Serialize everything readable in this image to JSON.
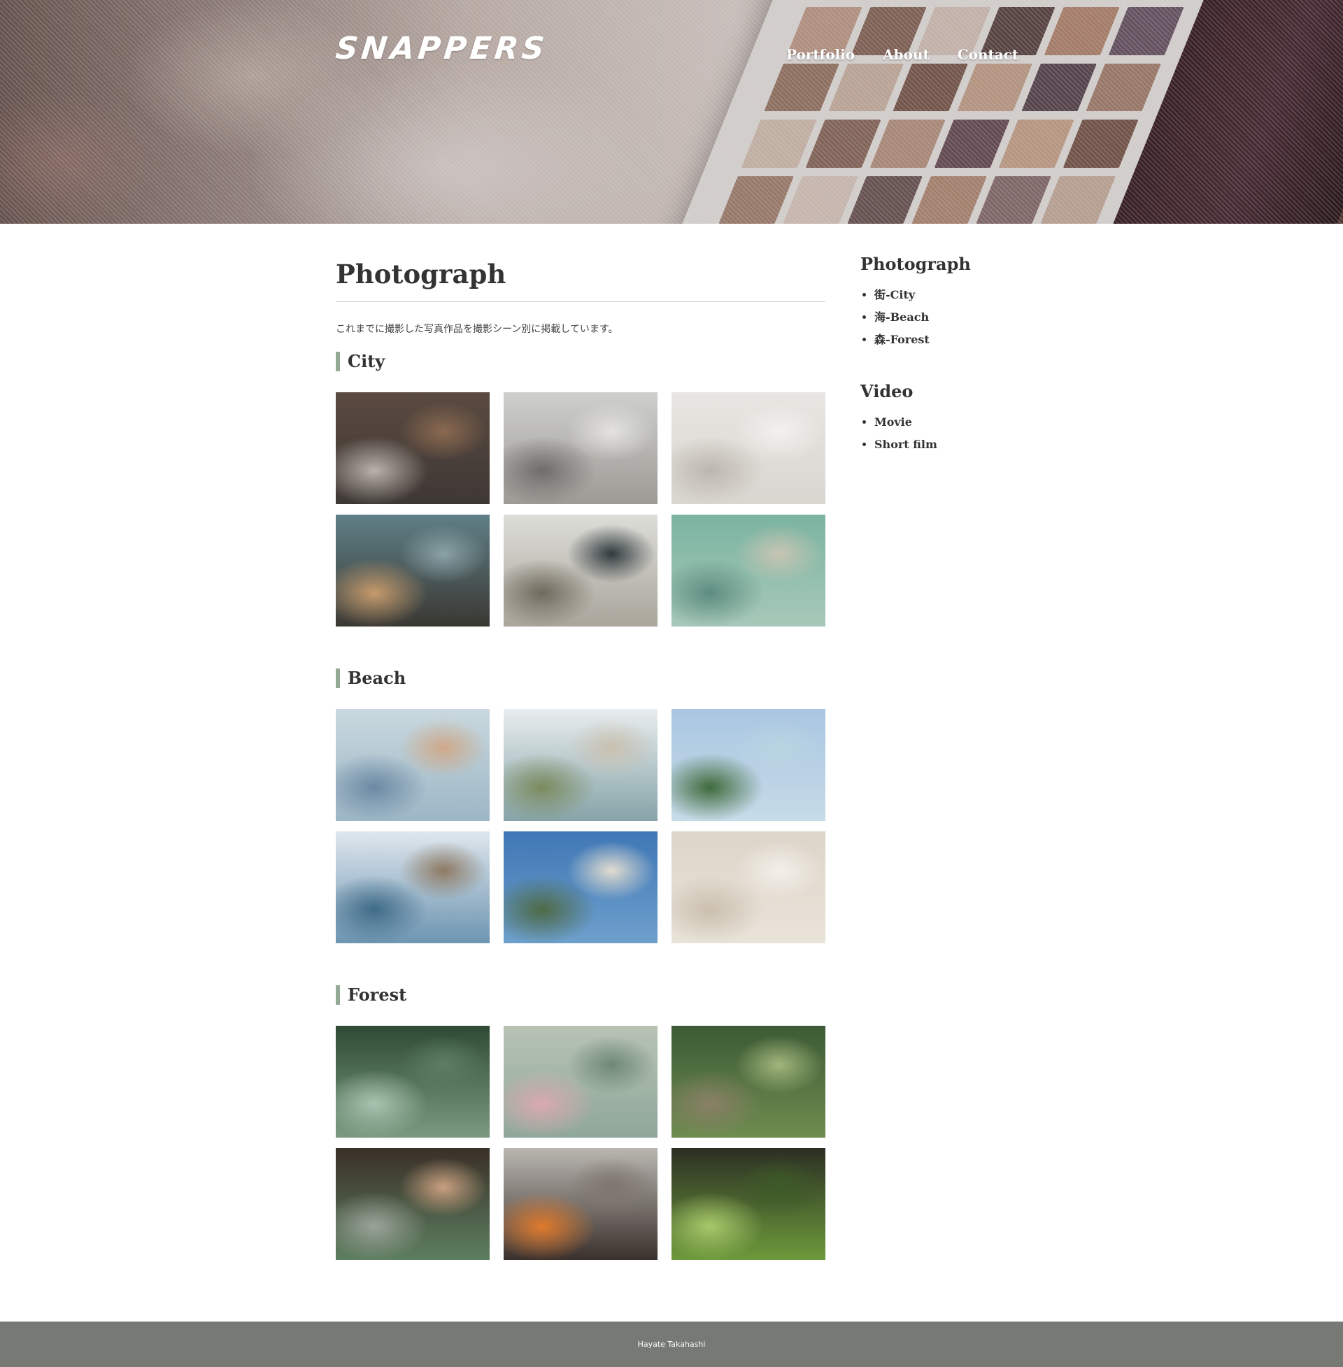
{
  "site": {
    "logo": "SNAPPERS"
  },
  "nav": [
    {
      "label": "Portfolio"
    },
    {
      "label": "About"
    },
    {
      "label": "Contact"
    }
  ],
  "main": {
    "title": "Photograph",
    "intro": "これまでに撮影した写真作品を撮影シーン別に掲載しています。",
    "sections": [
      {
        "title": "City",
        "photos": [
          {
            "colors": [
              "#5a4a40",
              "#3e3835",
              "#b8b2aa",
              "#8b6a50"
            ]
          },
          {
            "colors": [
              "#cfcfcc",
              "#9c9a95",
              "#6e6d6a",
              "#e3e2df"
            ]
          },
          {
            "colors": [
              "#e8e6e2",
              "#d9d6d0",
              "#bcb7ae",
              "#f2f1ee"
            ]
          },
          {
            "colors": [
              "#5f7f86",
              "#3a3833",
              "#c69a6b",
              "#8aa1a6"
            ]
          },
          {
            "colors": [
              "#ddddd8",
              "#a9a59b",
              "#6f6a5d",
              "#2f3a3d"
            ]
          },
          {
            "colors": [
              "#7bb4a1",
              "#a7c8b8",
              "#5d8c7f",
              "#c8c4b2"
            ]
          }
        ]
      },
      {
        "title": "Beach",
        "photos": [
          {
            "colors": [
              "#c9d8de",
              "#9db7c6",
              "#6b89a3",
              "#cfa989"
            ]
          },
          {
            "colors": [
              "#e9edef",
              "#86a4a8",
              "#7a8a5e",
              "#c9c1b0"
            ]
          },
          {
            "colors": [
              "#a9c6e2",
              "#c7dbe8",
              "#3e6a3a",
              "#b8d4e0"
            ]
          },
          {
            "colors": [
              "#dfe7ee",
              "#6d95b1",
              "#3f6b87",
              "#8e7a63"
            ]
          },
          {
            "colors": [
              "#3f77b6",
              "#6ea0cc",
              "#4e6a45",
              "#e1dccf"
            ]
          },
          {
            "colors": [
              "#dcd5c9",
              "#e9e3d9",
              "#cbbfae",
              "#f3efe9"
            ]
          }
        ]
      },
      {
        "title": "Forest",
        "photos": [
          {
            "colors": [
              "#2f4a34",
              "#7a9a80",
              "#a9c3b0",
              "#5d7d62"
            ]
          },
          {
            "colors": [
              "#b8c3b4",
              "#8ea79a",
              "#d9a9b0",
              "#6e8777"
            ]
          },
          {
            "colors": [
              "#3c5a35",
              "#6e8d4f",
              "#8a8066",
              "#a2b57c"
            ]
          },
          {
            "colors": [
              "#3a3028",
              "#5d7e5f",
              "#9aa49a",
              "#c99f7f"
            ]
          },
          {
            "colors": [
              "#b9b6b0",
              "#3a302c",
              "#e07a2c",
              "#7d756d"
            ]
          },
          {
            "colors": [
              "#2b2f24",
              "#6c9a3a",
              "#a9c86b",
              "#3e5a28"
            ]
          }
        ]
      }
    ]
  },
  "sidebar": {
    "photograph_heading": "Photograph",
    "photograph_items": [
      "街-City",
      "海-Beach",
      "森-Forest"
    ],
    "video_heading": "Video",
    "video_items": [
      "Movie",
      "Short film"
    ]
  },
  "footer": {
    "text": "Hayate Takahashi"
  }
}
